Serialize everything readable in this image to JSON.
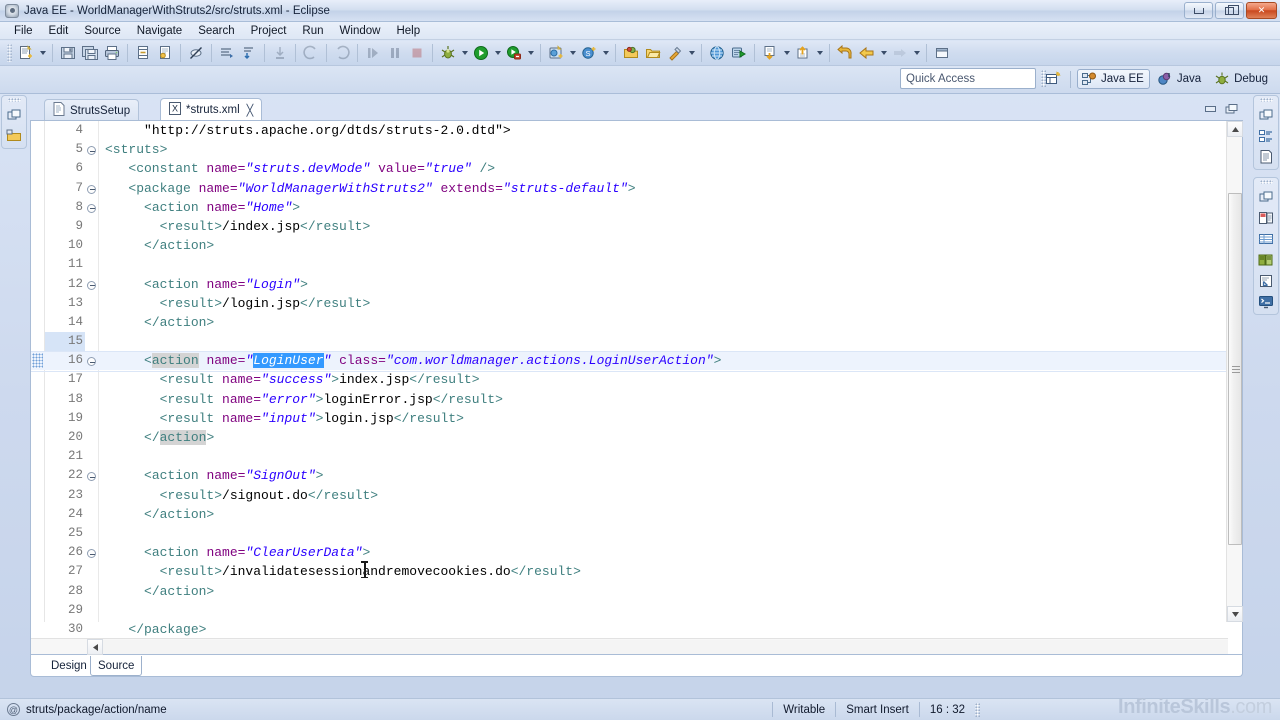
{
  "window": {
    "title": "Java EE - WorldManagerWithStruts2/src/struts.xml - Eclipse",
    "app_icon": "eclipse-icon",
    "minimize_label": "Minimize",
    "restore_label": "Restore",
    "close_label": "Close"
  },
  "menubar": {
    "items": [
      {
        "label": "File"
      },
      {
        "label": "Edit"
      },
      {
        "label": "Source"
      },
      {
        "label": "Navigate"
      },
      {
        "label": "Search"
      },
      {
        "label": "Project"
      },
      {
        "label": "Run"
      },
      {
        "label": "Window"
      },
      {
        "label": "Help"
      }
    ]
  },
  "toolbar": {
    "groups": [
      {
        "buttons": [
          {
            "icon": "new-wizard-icon",
            "dropdown": true
          },
          {
            "icon": "save-icon",
            "dropdown": false
          },
          {
            "icon": "save-all-icon",
            "dropdown": false
          },
          {
            "icon": "print-icon",
            "dropdown": false
          }
        ]
      },
      {
        "buttons": [
          {
            "icon": "build-all-icon",
            "dropdown": false
          },
          {
            "icon": "validate-icon",
            "dropdown": false
          }
        ]
      },
      {
        "buttons": [
          {
            "icon": "toggle-marker-icon",
            "dropdown": false
          }
        ]
      },
      {
        "buttons": [
          {
            "icon": "next-annotation-icon",
            "dropdown": false
          },
          {
            "icon": "previous-annotation-icon",
            "dropdown": false
          }
        ]
      },
      {
        "buttons": [
          {
            "icon": "step-into-icon",
            "dropdown": false
          },
          {
            "icon": "step-back-icon",
            "dropdown": false
          },
          {
            "icon": "step-forward-icon",
            "dropdown": false
          }
        ]
      },
      {
        "buttons": [
          {
            "icon": "resume-icon",
            "dropdown": false
          },
          {
            "icon": "suspend-icon",
            "dropdown": false
          },
          {
            "icon": "terminate-icon",
            "dropdown": false
          }
        ]
      },
      {
        "buttons": [
          {
            "icon": "debug-icon",
            "dropdown": true
          },
          {
            "icon": "run-icon",
            "dropdown": true
          },
          {
            "icon": "run-external-tools-icon",
            "dropdown": true
          }
        ]
      },
      {
        "buttons": [
          {
            "icon": "new-java-project-icon",
            "dropdown": true
          },
          {
            "icon": "new-server-icon",
            "dropdown": true
          }
        ]
      },
      {
        "buttons": [
          {
            "icon": "open-type-icon",
            "dropdown": false
          },
          {
            "icon": "open-task-icon",
            "dropdown": false
          },
          {
            "icon": "search-icon",
            "dropdown": true
          }
        ]
      },
      {
        "buttons": [
          {
            "icon": "web-browser-icon",
            "dropdown": false
          },
          {
            "icon": "run-on-server-icon",
            "dropdown": false
          }
        ]
      },
      {
        "buttons": [
          {
            "icon": "download-icon",
            "dropdown": true
          },
          {
            "icon": "upload-icon",
            "dropdown": true
          }
        ]
      },
      {
        "buttons": [
          {
            "icon": "back-history-icon",
            "dropdown": false
          },
          {
            "icon": "previous-edit-icon",
            "dropdown": true
          },
          {
            "icon": "next-edit-icon",
            "dropdown": true
          }
        ]
      },
      {
        "buttons": [
          {
            "icon": "restore-window-icon",
            "dropdown": false
          }
        ]
      }
    ]
  },
  "quick_access": {
    "placeholder": "Quick Access",
    "value": ""
  },
  "perspectives": {
    "open_perspective_icon": "open-perspective-icon",
    "items": [
      {
        "label": "Java EE",
        "icon": "java-ee-perspective-icon",
        "active": true
      },
      {
        "label": "Java",
        "icon": "java-perspective-icon",
        "active": false
      },
      {
        "label": "Debug",
        "icon": "debug-perspective-icon",
        "active": false
      }
    ]
  },
  "left_fastview": {
    "groups": [
      {
        "icons": [
          "restore-view-icon",
          "project-explorer-icon"
        ]
      }
    ]
  },
  "right_fastview": {
    "groups": [
      {
        "icons": [
          "restore-view-icon",
          "outline-view-icon",
          "task-list-icon"
        ]
      },
      {
        "icons": [
          "restore-view-icon",
          "palette-view-icon",
          "properties-view-icon",
          "servers-view-icon",
          "snippets-view-icon",
          "console-view-icon"
        ]
      }
    ]
  },
  "editor": {
    "tabs": [
      {
        "label": "StrutsSetup",
        "icon": "file-icon",
        "active": false,
        "dirty": false,
        "closeable": false
      },
      {
        "label": "*struts.xml",
        "icon": "xml-file-icon",
        "active": true,
        "dirty": true,
        "closeable": true,
        "close_glyph": "╳"
      }
    ],
    "tab_buttons": [
      {
        "icon": "minimize-editor-icon"
      },
      {
        "icon": "maximize-editor-icon"
      }
    ],
    "bottom_tabs": [
      {
        "label": "Design",
        "active": false
      },
      {
        "label": "Source",
        "active": true
      }
    ],
    "first_visible_line": 4,
    "lines": [
      {
        "num": 4,
        "fold": false,
        "indent": 5,
        "segments": [
          {
            "t": "\"http://struts.apache.org/dtds/struts-2.0.dtd\">",
            "c": "tx"
          }
        ]
      },
      {
        "num": 5,
        "fold": true,
        "indent": 0,
        "segments": [
          {
            "t": "<struts>",
            "c": "tg"
          }
        ]
      },
      {
        "num": 6,
        "fold": false,
        "indent": 3,
        "segments": [
          {
            "t": "<constant ",
            "c": "tg"
          },
          {
            "t": "name=",
            "c": "an"
          },
          {
            "t": "\"struts.devMode\"",
            "c": "av"
          },
          {
            "t": " ",
            "c": "tx"
          },
          {
            "t": "value=",
            "c": "an"
          },
          {
            "t": "\"true\"",
            "c": "av"
          },
          {
            "t": " />",
            "c": "tg"
          }
        ]
      },
      {
        "num": 7,
        "fold": true,
        "indent": 3,
        "segments": [
          {
            "t": "<package ",
            "c": "tg"
          },
          {
            "t": "name=",
            "c": "an"
          },
          {
            "t": "\"WorldManagerWithStruts2\"",
            "c": "av"
          },
          {
            "t": " ",
            "c": "tx"
          },
          {
            "t": "extends=",
            "c": "an"
          },
          {
            "t": "\"struts-default\"",
            "c": "av"
          },
          {
            "t": ">",
            "c": "tg"
          }
        ]
      },
      {
        "num": 8,
        "fold": true,
        "indent": 5,
        "segments": [
          {
            "t": "<action ",
            "c": "tg"
          },
          {
            "t": "name=",
            "c": "an"
          },
          {
            "t": "\"Home\"",
            "c": "av"
          },
          {
            "t": ">",
            "c": "tg"
          }
        ]
      },
      {
        "num": 9,
        "fold": false,
        "indent": 7,
        "segments": [
          {
            "t": "<result>",
            "c": "tg"
          },
          {
            "t": "/index.jsp",
            "c": "tx"
          },
          {
            "t": "</result>",
            "c": "tg"
          }
        ]
      },
      {
        "num": 10,
        "fold": false,
        "indent": 5,
        "segments": [
          {
            "t": "</action>",
            "c": "tg"
          }
        ]
      },
      {
        "num": 11,
        "fold": false,
        "indent": 0,
        "segments": []
      },
      {
        "num": 12,
        "fold": true,
        "indent": 5,
        "segments": [
          {
            "t": "<action ",
            "c": "tg"
          },
          {
            "t": "name=",
            "c": "an"
          },
          {
            "t": "\"Login\"",
            "c": "av"
          },
          {
            "t": ">",
            "c": "tg"
          }
        ]
      },
      {
        "num": 13,
        "fold": false,
        "indent": 7,
        "segments": [
          {
            "t": "<result>",
            "c": "tg"
          },
          {
            "t": "/login.jsp",
            "c": "tx"
          },
          {
            "t": "</result>",
            "c": "tg"
          }
        ]
      },
      {
        "num": 14,
        "fold": false,
        "indent": 5,
        "segments": [
          {
            "t": "</action>",
            "c": "tg"
          }
        ]
      },
      {
        "num": 15,
        "fold": false,
        "indent": 0,
        "segments": [],
        "gutter_marked": true
      },
      {
        "num": 16,
        "fold": true,
        "indent": 5,
        "current": true,
        "segments": [
          {
            "t": "<",
            "c": "tg"
          },
          {
            "t": "action",
            "c": "tg occ"
          },
          {
            "t": " ",
            "c": "tg"
          },
          {
            "t": "name=",
            "c": "an"
          },
          {
            "t": "\"",
            "c": "av"
          },
          {
            "t": "LoginUser",
            "c": "av sel"
          },
          {
            "t": "\"",
            "c": "av"
          },
          {
            "t": " ",
            "c": "tx"
          },
          {
            "t": "class=",
            "c": "an"
          },
          {
            "t": "\"com.worldmanager.actions.LoginUserAction\"",
            "c": "av"
          },
          {
            "t": ">",
            "c": "tg"
          }
        ]
      },
      {
        "num": 17,
        "fold": false,
        "indent": 7,
        "segments": [
          {
            "t": "<result ",
            "c": "tg"
          },
          {
            "t": "name=",
            "c": "an"
          },
          {
            "t": "\"success\"",
            "c": "av"
          },
          {
            "t": ">",
            "c": "tg"
          },
          {
            "t": "index.jsp",
            "c": "tx"
          },
          {
            "t": "</result>",
            "c": "tg"
          }
        ]
      },
      {
        "num": 18,
        "fold": false,
        "indent": 7,
        "segments": [
          {
            "t": "<result ",
            "c": "tg"
          },
          {
            "t": "name=",
            "c": "an"
          },
          {
            "t": "\"error\"",
            "c": "av"
          },
          {
            "t": ">",
            "c": "tg"
          },
          {
            "t": "loginError.jsp",
            "c": "tx"
          },
          {
            "t": "</result>",
            "c": "tg"
          }
        ]
      },
      {
        "num": 19,
        "fold": false,
        "indent": 7,
        "segments": [
          {
            "t": "<result ",
            "c": "tg"
          },
          {
            "t": "name=",
            "c": "an"
          },
          {
            "t": "\"input\"",
            "c": "av"
          },
          {
            "t": ">",
            "c": "tg"
          },
          {
            "t": "login.jsp",
            "c": "tx"
          },
          {
            "t": "</result>",
            "c": "tg"
          }
        ]
      },
      {
        "num": 20,
        "fold": false,
        "indent": 5,
        "segments": [
          {
            "t": "</",
            "c": "tg"
          },
          {
            "t": "action",
            "c": "tg occ"
          },
          {
            "t": ">",
            "c": "tg"
          }
        ]
      },
      {
        "num": 21,
        "fold": false,
        "indent": 0,
        "segments": []
      },
      {
        "num": 22,
        "fold": true,
        "indent": 5,
        "segments": [
          {
            "t": "<action ",
            "c": "tg"
          },
          {
            "t": "name=",
            "c": "an"
          },
          {
            "t": "\"SignOut\"",
            "c": "av"
          },
          {
            "t": ">",
            "c": "tg"
          }
        ]
      },
      {
        "num": 23,
        "fold": false,
        "indent": 7,
        "segments": [
          {
            "t": "<result>",
            "c": "tg"
          },
          {
            "t": "/signout.do",
            "c": "tx"
          },
          {
            "t": "</result>",
            "c": "tg"
          }
        ]
      },
      {
        "num": 24,
        "fold": false,
        "indent": 5,
        "segments": [
          {
            "t": "</action>",
            "c": "tg"
          }
        ]
      },
      {
        "num": 25,
        "fold": false,
        "indent": 0,
        "segments": []
      },
      {
        "num": 26,
        "fold": true,
        "indent": 5,
        "segments": [
          {
            "t": "<action ",
            "c": "tg"
          },
          {
            "t": "name=",
            "c": "an"
          },
          {
            "t": "\"ClearUserData\"",
            "c": "av"
          },
          {
            "t": ">",
            "c": "tg"
          }
        ]
      },
      {
        "num": 27,
        "fold": false,
        "indent": 7,
        "segments": [
          {
            "t": "<result>",
            "c": "tg"
          },
          {
            "t": "/invalidatesessionandremovecookies.do",
            "c": "tx"
          },
          {
            "t": "</result>",
            "c": "tg"
          }
        ]
      },
      {
        "num": 28,
        "fold": false,
        "indent": 5,
        "segments": [
          {
            "t": "</action>",
            "c": "tg"
          }
        ]
      },
      {
        "num": 29,
        "fold": false,
        "indent": 0,
        "segments": []
      },
      {
        "num": 30,
        "fold": false,
        "indent": 3,
        "segments": [
          {
            "t": "</package>",
            "c": "tg"
          }
        ]
      }
    ]
  },
  "statusbar": {
    "breadcrumb_icon": "at-sign-icon",
    "breadcrumb": "struts/package/action/name",
    "writable": "Writable",
    "insert_mode": "Smart Insert",
    "cursor_position": "16 : 32"
  },
  "watermark": {
    "brand": "InfiniteSkills",
    "tld": ".com"
  },
  "colors": {
    "tag": "#3f7f7f",
    "attribute_name": "#7f007f",
    "attribute_value": "#2a00ff",
    "selection": "#3399ff",
    "occurrence": "#d4d4d4",
    "current_line": "#edf3fd",
    "chrome": "#cdd9ee"
  }
}
